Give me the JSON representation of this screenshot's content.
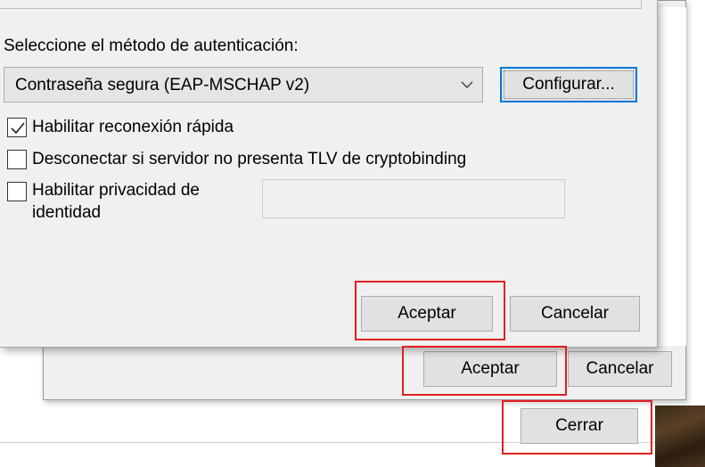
{
  "front_dialog": {
    "auth_method_label": "Seleccione el método de autenticación:",
    "auth_method_selected": "Contraseña segura (EAP-MSCHAP v2)",
    "configure_button": "Configurar...",
    "checkbox_fast_reconnect": {
      "label": "Habilitar reconexión rápida",
      "checked": true
    },
    "checkbox_disconnect_tlv": {
      "label": "Desconectar si servidor no presenta TLV de cryptobinding",
      "checked": false
    },
    "checkbox_identity_privacy": {
      "label_line1": "Habilitar privacidad de",
      "label_line2": "identidad",
      "checked": false
    },
    "identity_field_value": "",
    "ok_button": "Aceptar",
    "cancel_button": "Cancelar"
  },
  "middle_dialog": {
    "ok_button": "Aceptar",
    "cancel_button": "Cancelar"
  },
  "back_dialog": {
    "close_button": "Cerrar"
  },
  "colors": {
    "highlight": "#e02020",
    "focus_border": "#0078d7",
    "dialog_bg": "#f0f0f0",
    "button_bg": "#e1e1e1"
  },
  "icons": {
    "combo_arrow": "chevron-down-icon",
    "checkmark": "checkmark-icon"
  }
}
